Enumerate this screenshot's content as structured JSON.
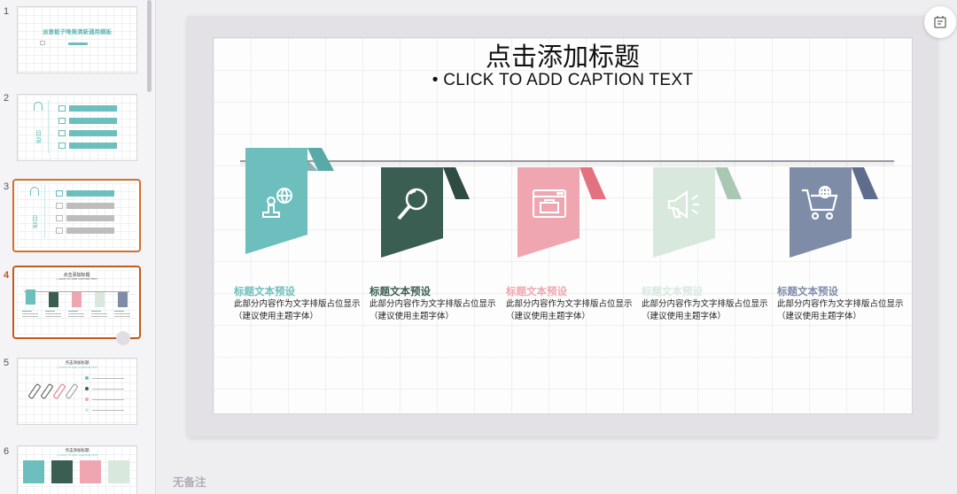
{
  "thumbnails": [
    {
      "num": "1",
      "title": "淡意栀子唯美清新通用模板"
    },
    {
      "num": "2",
      "toc_word": "目录"
    },
    {
      "num": "3",
      "toc_word": "目录"
    },
    {
      "num": "4",
      "title": "点击添加标题",
      "subtitle": "• CLICK TO ADD CAPTION TEXT"
    },
    {
      "num": "5",
      "title": "点击添加标题",
      "subtitle": "• CLICK TO ADD CAPTION TEXT"
    },
    {
      "num": "6",
      "title": "点击添加标题",
      "subtitle": "• CLICK TO ADD CAPTION TEXT"
    }
  ],
  "slide": {
    "title": "点击添加标题",
    "caption": "• CLICK TO ADD CAPTION TEXT",
    "items": [
      {
        "icon": "stamp-globe-icon",
        "color": "#6cbfbd",
        "fold": "#58a9a7",
        "title": "标题文本预设",
        "title_color": "#6cbfbd",
        "body": "此部分内容作为文字排版占位显示（建议使用主题字体）"
      },
      {
        "icon": "magnifier-icon",
        "color": "#3a5f52",
        "fold": "#2e4c41",
        "title": "标题文本预设",
        "title_color": "#3a5f52",
        "body": "此部分内容作为文字排版占位显示（建议使用主题字体）"
      },
      {
        "icon": "browser-window-icon",
        "color": "#f0a6b0",
        "fold": "#e4717f",
        "title": "标题文本预设",
        "title_color": "#f0a6b0",
        "body": "此部分内容作为文字排版占位显示（建议使用主题字体）"
      },
      {
        "icon": "megaphone-icon",
        "color": "#d8e8dd",
        "fold": "#a9c8b3",
        "title": "标题文本预设",
        "title_color": "#d8e8dd",
        "body": "此部分内容作为文字排版占位显示（建议使用主题字体）"
      },
      {
        "icon": "shopping-cart-icon",
        "color": "#7f8ca8",
        "fold": "#5f6d8c",
        "title": "标题文本预设",
        "title_color": "#7f8ca8",
        "body": "此部分内容作为文字排版占位显示（建议使用主题字体）"
      }
    ]
  },
  "notes_placeholder": "无备注"
}
